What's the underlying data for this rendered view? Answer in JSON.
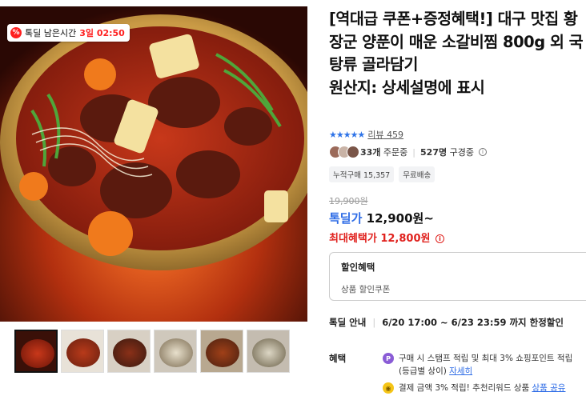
{
  "badge": {
    "icon": "%",
    "label": "톡딜 남은시간",
    "time": "3일 02:50"
  },
  "title": {
    "line": "[역대급 쿠폰+증정혜택!] 대구 맛집 황장군 양푼이 매운 소갈비찜 800g 외 국탕류 골라담기",
    "origin": "원산지: 상세설명에 표시"
  },
  "rating": {
    "stars": "★★★★★",
    "review_label": "리뷰",
    "review_count": "459"
  },
  "buyers": {
    "orders": "33개",
    "orders_label": " 주문중",
    "viewers": "527명",
    "viewers_label": " 구경중"
  },
  "chips": [
    "누적구매 15,357",
    "무료배송"
  ],
  "price": {
    "original": "19,900원",
    "deal_label": "톡딜가",
    "deal_value": "12,900원~",
    "max_label": "최대혜택가",
    "max_value": "12,800원"
  },
  "discount": {
    "heading": "할인혜택",
    "sub": "상품 할인쿠폰"
  },
  "deal_info": {
    "label": "톡딜 안내",
    "value": "6/20 17:00 ~ 6/23 23:59 까지 한정할인"
  },
  "benefits": {
    "label": "혜택",
    "items": [
      {
        "icon": "P",
        "text": "구매 시 스탬프 적립 및 최대 3% 쇼핑포인트 적립",
        "text2": "(등급별 상이) ",
        "link": "자세히"
      },
      {
        "icon": "◉",
        "text": "결제 금액 3% 적립! 추천리워드 상품 ",
        "link": "상품 공유"
      }
    ]
  },
  "colors": {
    "accent_blue": "#2e6ce6",
    "accent_red": "#e0211d",
    "star": "#2f74e8"
  }
}
